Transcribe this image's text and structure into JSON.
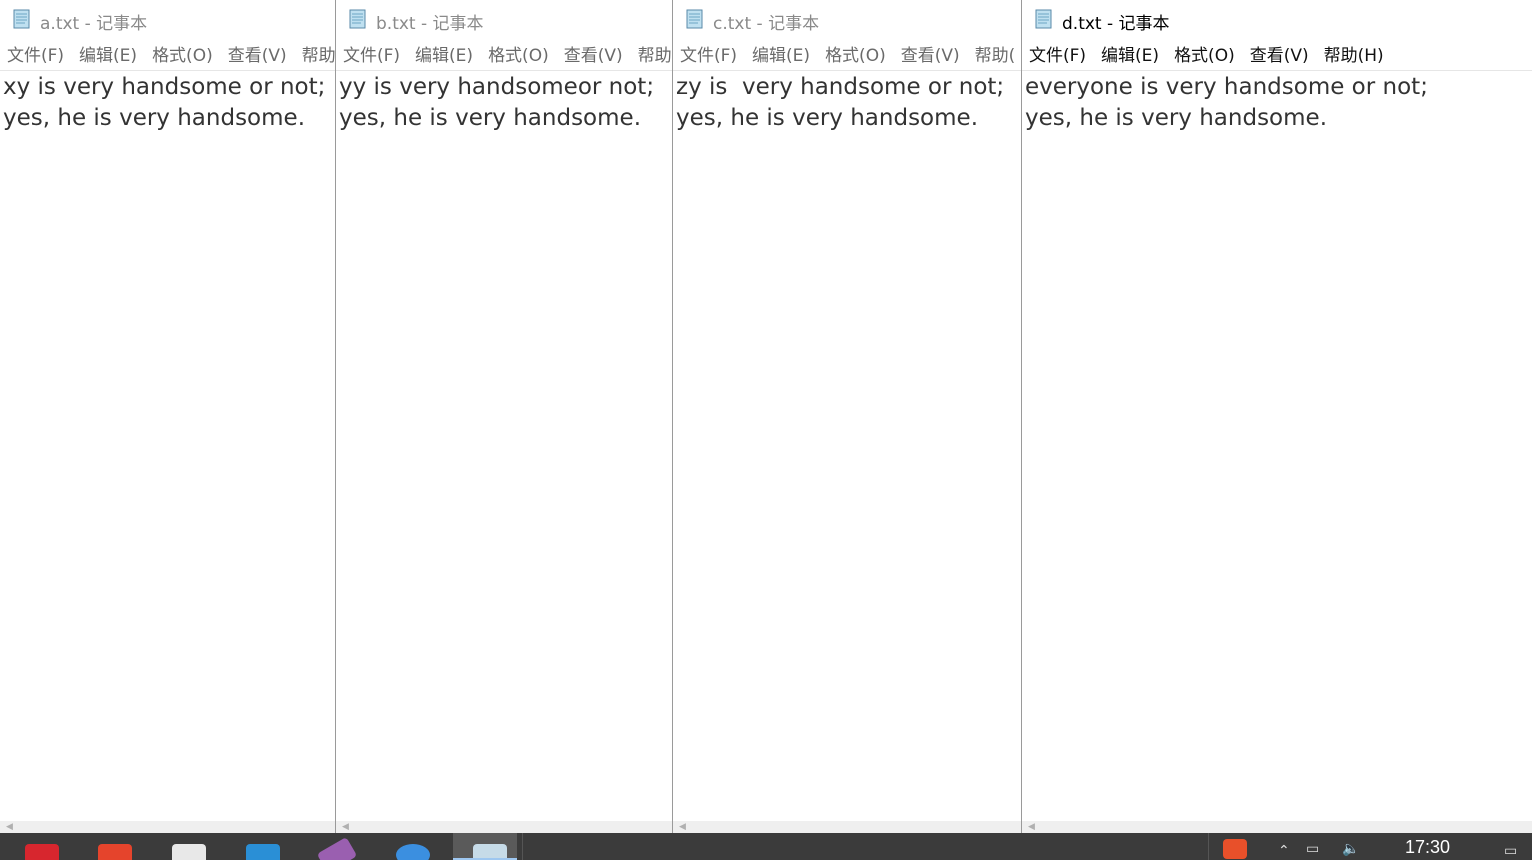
{
  "windows": [
    {
      "title": "a.txt - 记事本",
      "menu": [
        "文件(F)",
        "编辑(E)",
        "格式(O)",
        "查看(V)",
        "帮助"
      ],
      "content": "xy is very handsome or not;\nyes, he is very handsome.",
      "active": false
    },
    {
      "title": "b.txt - 记事本",
      "menu": [
        "文件(F)",
        "编辑(E)",
        "格式(O)",
        "查看(V)",
        "帮助"
      ],
      "content": "yy is very handsomeor not;\nyes, he is very handsome.",
      "active": false
    },
    {
      "title": "c.txt - 记事本",
      "menu": [
        "文件(F)",
        "编辑(E)",
        "格式(O)",
        "查看(V)",
        "帮助("
      ],
      "content": "zy is  very handsome or not;\nyes, he is very handsome.",
      "active": false
    },
    {
      "title": "d.txt - 记事本",
      "menu": [
        "文件(F)",
        "编辑(E)",
        "格式(O)",
        "查看(V)",
        "帮助(H)"
      ],
      "content": "everyone is very handsome or not;\nyes, he is very handsome.",
      "active": true
    }
  ],
  "taskbar": {
    "clock": "17:30",
    "apps": [
      {
        "icon": "red-app-icon",
        "color": "#d7262e"
      },
      {
        "icon": "wps-icon",
        "color": "#e5442c"
      },
      {
        "icon": "text-editor-icon",
        "color": "#e8e8e8"
      },
      {
        "icon": "blue-app-icon",
        "color": "#2a8fd6"
      },
      {
        "icon": "paint-icon",
        "color": "#9a5fb0"
      },
      {
        "icon": "blue-circle-app-icon",
        "color": "#3b8fe0"
      },
      {
        "icon": "notepad-icon",
        "color": "#c6dbe8"
      }
    ],
    "ime_icon": "sogou-ime-icon",
    "ime_color": "#e8502a"
  }
}
